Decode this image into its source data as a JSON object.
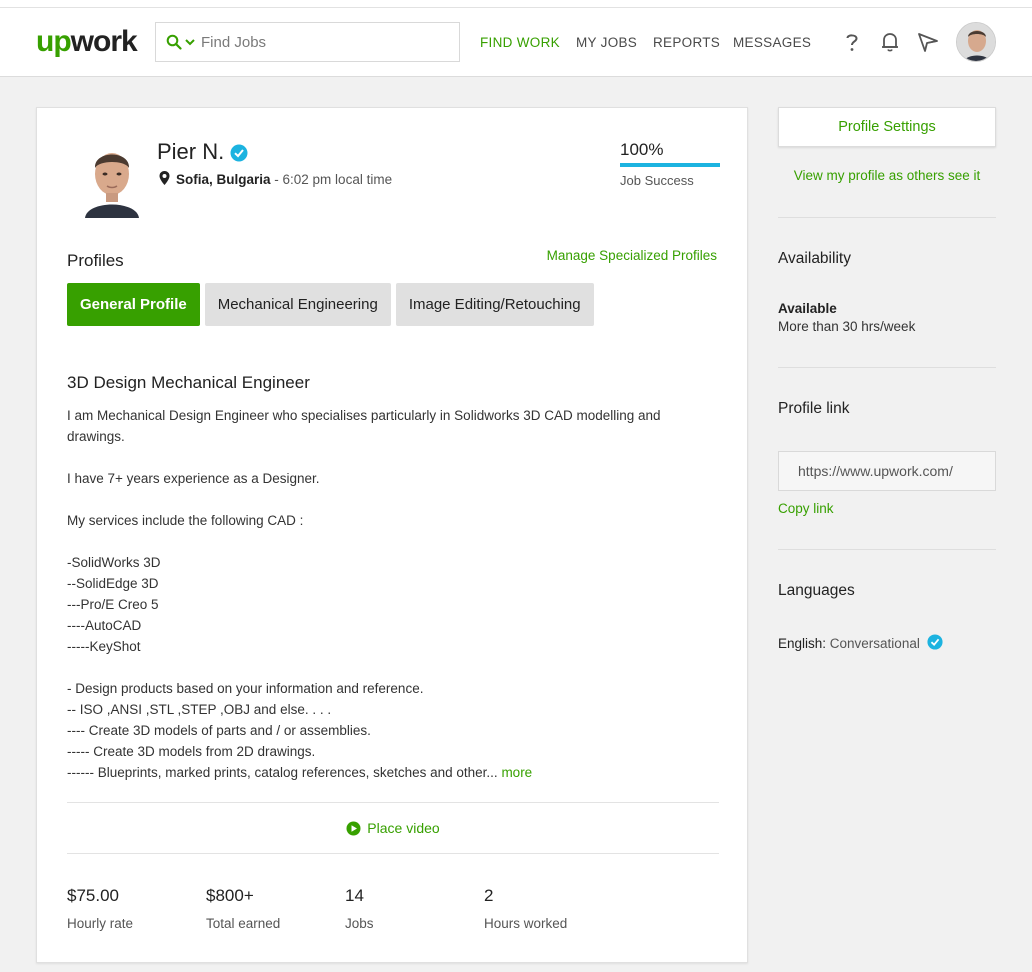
{
  "header": {
    "logo_up": "up",
    "logo_work": "work",
    "search_placeholder": "Find Jobs",
    "nav": [
      "FIND WORK",
      "MY JOBS",
      "REPORTS",
      "MESSAGES"
    ]
  },
  "profile": {
    "name": "Pier N.",
    "city": "Sofia, Bulgaria",
    "local_time": " - 6:02 pm local time",
    "job_success_pct": "100%",
    "job_success_value": 1.0,
    "job_success_label": "Job Success"
  },
  "profiles_section": {
    "heading": "Profiles",
    "manage_link": "Manage Specialized Profiles",
    "tabs": [
      "General Profile",
      "Mechanical Engineering",
      "Image Editing/Retouching"
    ],
    "active_tab": 0
  },
  "overview": {
    "title": "3D Design Mechanical Engineer",
    "lines": [
      "I am Mechanical Design Engineer who specialises particularly in Solidworks 3D CAD modelling and drawings.",
      "",
      "I have 7+ years experience as a Designer.",
      "",
      "My services include the following CAD :",
      "",
      "-SolidWorks 3D",
      "--SolidEdge 3D",
      "---Pro/E Creo 5",
      "----AutoCAD",
      "-----KeyShot",
      "",
      "- Design products based on your information and reference.",
      "-- ISO ,ANSI ,STL ,STEP ,OBJ and else. . . .",
      "---- Create 3D models of parts and / or assemblies.",
      "----- Create 3D models from 2D drawings."
    ],
    "last_line": "------ Blueprints, marked prints, catalog references, sketches and other... ",
    "more_link": "more",
    "video_link": "Place video"
  },
  "stats": [
    {
      "value": "$75.00",
      "label": "Hourly rate"
    },
    {
      "value": "$800+",
      "label": "Total earned"
    },
    {
      "value": "14",
      "label": "Jobs"
    },
    {
      "value": "2",
      "label": "Hours worked"
    }
  ],
  "sidebar": {
    "settings_button": "Profile Settings",
    "view_link": "View my profile as others see it",
    "availability_heading": "Availability",
    "availability_status": "Available",
    "availability_hours": "More than 30 hrs/week",
    "profile_link_heading": "Profile link",
    "profile_link_url": "https://www.upwork.com/",
    "copy_link": "Copy link",
    "languages_heading": "Languages",
    "language_name": "English:",
    "language_level": " Conversational"
  },
  "colors": {
    "brand_green": "#37a000",
    "verified_blue": "#1cb3e0",
    "page_bg": "#f1f1f1"
  },
  "icons": [
    "search-icon",
    "chevron-down-icon",
    "help-icon",
    "bell-icon",
    "send-icon",
    "location-pin-icon",
    "verified-badge-icon",
    "play-icon"
  ]
}
